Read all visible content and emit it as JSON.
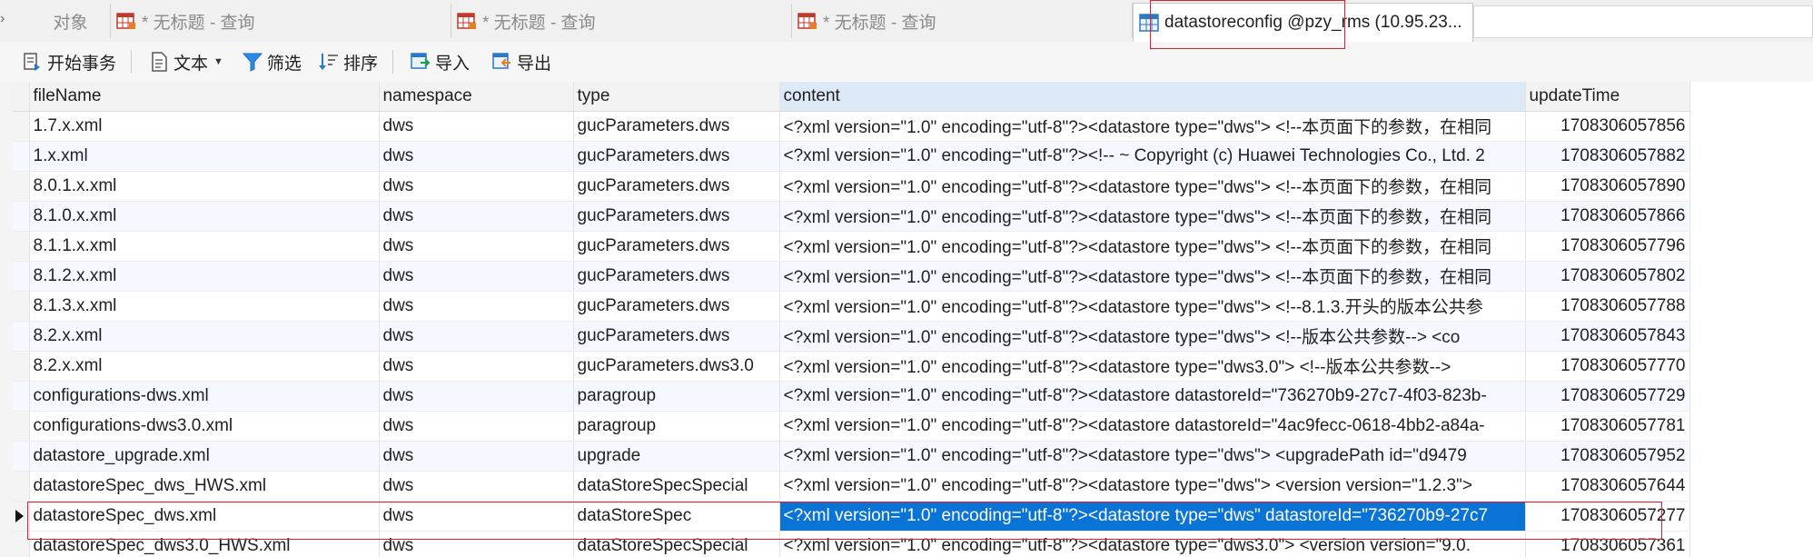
{
  "tabs": [
    {
      "label": "对象",
      "icon": "none"
    },
    {
      "label": "* 无标题 - 查询",
      "icon": "query-table-icon"
    },
    {
      "label": "* 无标题 - 查询",
      "icon": "query-table-icon"
    },
    {
      "label": "* 无标题 - 查询",
      "icon": "query-table-icon"
    },
    {
      "label": "datastoreconfig @pzy_rms (10.95.23...",
      "icon": "table-icon"
    }
  ],
  "toolbar": {
    "begin_tx": "开始事务",
    "text": "文本",
    "filter": "筛选",
    "sort": "排序",
    "import": "导入",
    "export": "导出"
  },
  "grid": {
    "columns": [
      "fileName",
      "namespace",
      "type",
      "content",
      "updateTime"
    ],
    "selected_column": "content",
    "rows": [
      {
        "fileName": "1.7.x.xml",
        "namespace": "dws",
        "type": "gucParameters.dws",
        "content": "<?xml version=\"1.0\" encoding=\"utf-8\"?><datastore type=\"dws\">    <!--本页面下的参数，在相同",
        "updateTime": "1708306057856"
      },
      {
        "fileName": "1.x.xml",
        "namespace": "dws",
        "type": "gucParameters.dws",
        "content": "<?xml version=\"1.0\" encoding=\"utf-8\"?><!--  ~ Copyright (c) Huawei Technologies Co., Ltd. 2",
        "updateTime": "1708306057882"
      },
      {
        "fileName": "8.0.1.x.xml",
        "namespace": "dws",
        "type": "gucParameters.dws",
        "content": "<?xml version=\"1.0\" encoding=\"utf-8\"?><datastore type=\"dws\">    <!--本页面下的参数，在相同",
        "updateTime": "1708306057890"
      },
      {
        "fileName": "8.1.0.x.xml",
        "namespace": "dws",
        "type": "gucParameters.dws",
        "content": "<?xml version=\"1.0\" encoding=\"utf-8\"?><datastore type=\"dws\">    <!--本页面下的参数，在相同",
        "updateTime": "1708306057866"
      },
      {
        "fileName": "8.1.1.x.xml",
        "namespace": "dws",
        "type": "gucParameters.dws",
        "content": "<?xml version=\"1.0\" encoding=\"utf-8\"?><datastore type=\"dws\">    <!--本页面下的参数，在相同",
        "updateTime": "1708306057796"
      },
      {
        "fileName": "8.1.2.x.xml",
        "namespace": "dws",
        "type": "gucParameters.dws",
        "content": "<?xml version=\"1.0\" encoding=\"utf-8\"?><datastore type=\"dws\">    <!--本页面下的参数，在相同",
        "updateTime": "1708306057802"
      },
      {
        "fileName": "8.1.3.x.xml",
        "namespace": "dws",
        "type": "gucParameters.dws",
        "content": "<?xml version=\"1.0\" encoding=\"utf-8\"?><datastore type=\"dws\">    <!--8.1.3.开头的版本公共参",
        "updateTime": "1708306057788"
      },
      {
        "fileName": "8.2.x.xml",
        "namespace": "dws",
        "type": "gucParameters.dws",
        "content": "<?xml version=\"1.0\" encoding=\"utf-8\"?><datastore type=\"dws\">    <!--版本公共参数-->    <co",
        "updateTime": "1708306057843"
      },
      {
        "fileName": "8.2.x.xml",
        "namespace": "dws",
        "type": "gucParameters.dws3.0",
        "content": "<?xml version=\"1.0\" encoding=\"utf-8\"?><datastore type=\"dws3.0\">    <!--版本公共参数-->",
        "updateTime": "1708306057770"
      },
      {
        "fileName": "configurations-dws.xml",
        "namespace": "dws",
        "type": "paragroup",
        "content": "<?xml version=\"1.0\" encoding=\"utf-8\"?><datastore datastoreId=\"736270b9-27c7-4f03-823b-",
        "updateTime": "1708306057729"
      },
      {
        "fileName": "configurations-dws3.0.xml",
        "namespace": "dws",
        "type": "paragroup",
        "content": "<?xml version=\"1.0\" encoding=\"utf-8\"?><datastore datastoreId=\"4ac9fecc-0618-4bb2-a84a-",
        "updateTime": "1708306057781"
      },
      {
        "fileName": "datastore_upgrade.xml",
        "namespace": "dws",
        "type": "upgrade",
        "content": "<?xml version=\"1.0\" encoding=\"utf-8\"?><datastore type=\"dws\">    <upgradePath id=\"d9479",
        "updateTime": "1708306057952"
      },
      {
        "fileName": "datastoreSpec_dws_HWS.xml",
        "namespace": "dws",
        "type": "dataStoreSpecSpecial",
        "content": "<?xml version=\"1.0\" encoding=\"utf-8\"?><datastore type=\"dws\">    <version version=\"1.2.3\">",
        "updateTime": "1708306057644"
      },
      {
        "fileName": "datastoreSpec_dws.xml",
        "namespace": "dws",
        "type": "dataStoreSpec",
        "content": "<?xml version=\"1.0\" encoding=\"utf-8\"?><datastore type=\"dws\" datastoreId=\"736270b9-27c7",
        "updateTime": "1708306057277",
        "current": true
      },
      {
        "fileName": "datastoreSpec_dws3.0_HWS.xml",
        "namespace": "dws",
        "type": "dataStoreSpecSpecial",
        "content": "<?xml version=\"1.0\" encoding=\"utf-8\"?><datastore type=\"dws3.0\">    <version version=\"9.0.",
        "updateTime": "1708306057361"
      }
    ]
  }
}
